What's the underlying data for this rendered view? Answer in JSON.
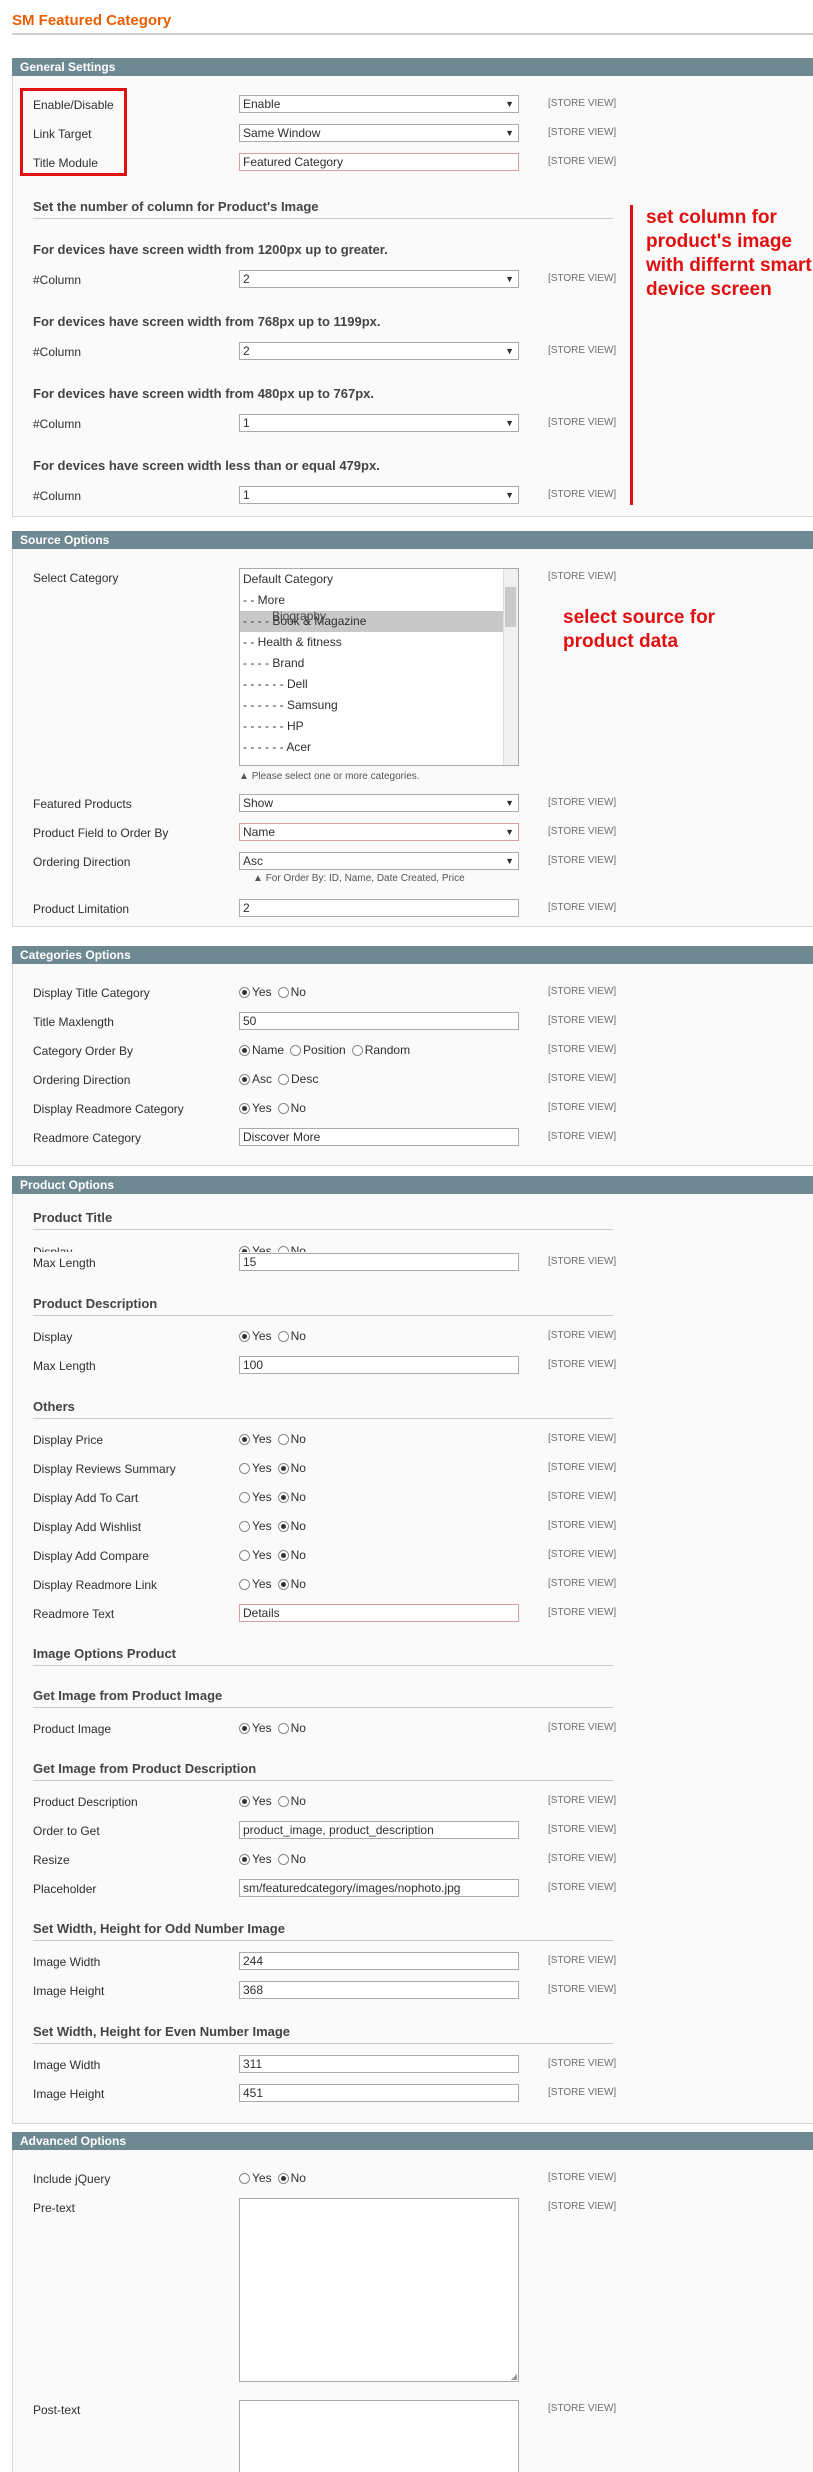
{
  "page_title": "SM Featured Category",
  "scope_label": "[STORE VIEW]",
  "general": {
    "header": "General Settings",
    "enable_label": "Enable/Disable",
    "enable_value": "Enable",
    "link_target_label": "Link Target",
    "link_target_value": "Same Window",
    "title_module_label": "Title Module",
    "title_module_value": "Featured Category",
    "columns_heading": "Set the number of column for Product's Image",
    "device_1200": "For devices have screen width from 1200px up to greater.",
    "device_768": "For devices have screen width from 768px up to 1199px.",
    "device_480": "For devices have screen width from 480px up to 767px.",
    "device_479": "For devices have screen width less than or equal 479px.",
    "column_label": "#Column",
    "col_1200": "2",
    "col_768": "2",
    "col_480": "1",
    "col_479": "1"
  },
  "annotations": {
    "columns_note": "set column for product's image with differnt smart device screen",
    "source_note": "select source for product data"
  },
  "source": {
    "header": "Source Options",
    "select_category_label": "Select Category",
    "categories": [
      "Default Category",
      "- - More",
      "- - - - Book & Magazine",
      "- - Health & fitness",
      "- - - - Brand",
      "- - - - - - Dell",
      "- - - - - - Samsung",
      "- - - - - - HP",
      "- - - - - - Acer"
    ],
    "category_overlay_text": "Biography",
    "category_hint": "Please select one or more categories.",
    "featured_label": "Featured Products",
    "featured_value": "Show",
    "order_field_label": "Product Field to Order By",
    "order_field_value": "Name",
    "ordering_label": "Ordering Direction",
    "ordering_value": "Asc",
    "order_hint": "For Order By: ID, Name, Date Created, Price",
    "limit_label": "Product Limitation",
    "limit_value": "2"
  },
  "categories_opts": {
    "header": "Categories Options",
    "display_title_label": "Display Title Category",
    "title_max_label": "Title Maxlength",
    "title_max_value": "50",
    "order_by_label": "Category Order By",
    "ordering_label": "Ordering Direction",
    "readmore_cat_label": "Display Readmore Category",
    "readmore_text_label": "Readmore Category",
    "readmore_text_value": "Discover More",
    "yes": "Yes",
    "no": "No",
    "name": "Name",
    "position": "Position",
    "random": "Random",
    "asc": "Asc",
    "desc": "Desc"
  },
  "product": {
    "header": "Product Options",
    "title_heading": "Product Title",
    "display_label": "Display",
    "max_length_label": "Max Length",
    "title_max_value": "15",
    "desc_heading": "Product Description",
    "desc_max_value": "100",
    "others_heading": "Others",
    "display_price": "Display Price",
    "display_reviews": "Display Reviews Summary",
    "display_cart": "Display Add To Cart",
    "display_wishlist": "Display Add Wishlist",
    "display_compare": "Display Add Compare",
    "display_readmore": "Display Readmore Link",
    "readmore_text_label": "Readmore Text",
    "readmore_text_value": "Details",
    "image_heading": "Image Options Product",
    "from_image_heading": "Get Image from Product Image",
    "product_image_label": "Product Image",
    "from_desc_heading": "Get Image from Product Description",
    "product_desc_label": "Product Description",
    "order_get_label": "Order to Get",
    "order_get_value": "product_image, product_description",
    "resize_label": "Resize",
    "placeholder_label": "Placeholder",
    "placeholder_value": "sm/featuredcategory/images/nophoto.jpg",
    "odd_heading": "Set Width, Height for Odd Number Image",
    "even_heading": "Set Width, Height for Even Number Image",
    "width_label": "Image Width",
    "height_label": "Image Height",
    "odd_width": "244",
    "odd_height": "368",
    "even_width": "311",
    "even_height": "451",
    "yes": "Yes",
    "no": "No"
  },
  "advanced": {
    "header": "Advanced Options",
    "jquery_label": "Include jQuery",
    "pretext_label": "Pre-text",
    "posttext_label": "Post-text",
    "yes": "Yes",
    "no": "No"
  }
}
